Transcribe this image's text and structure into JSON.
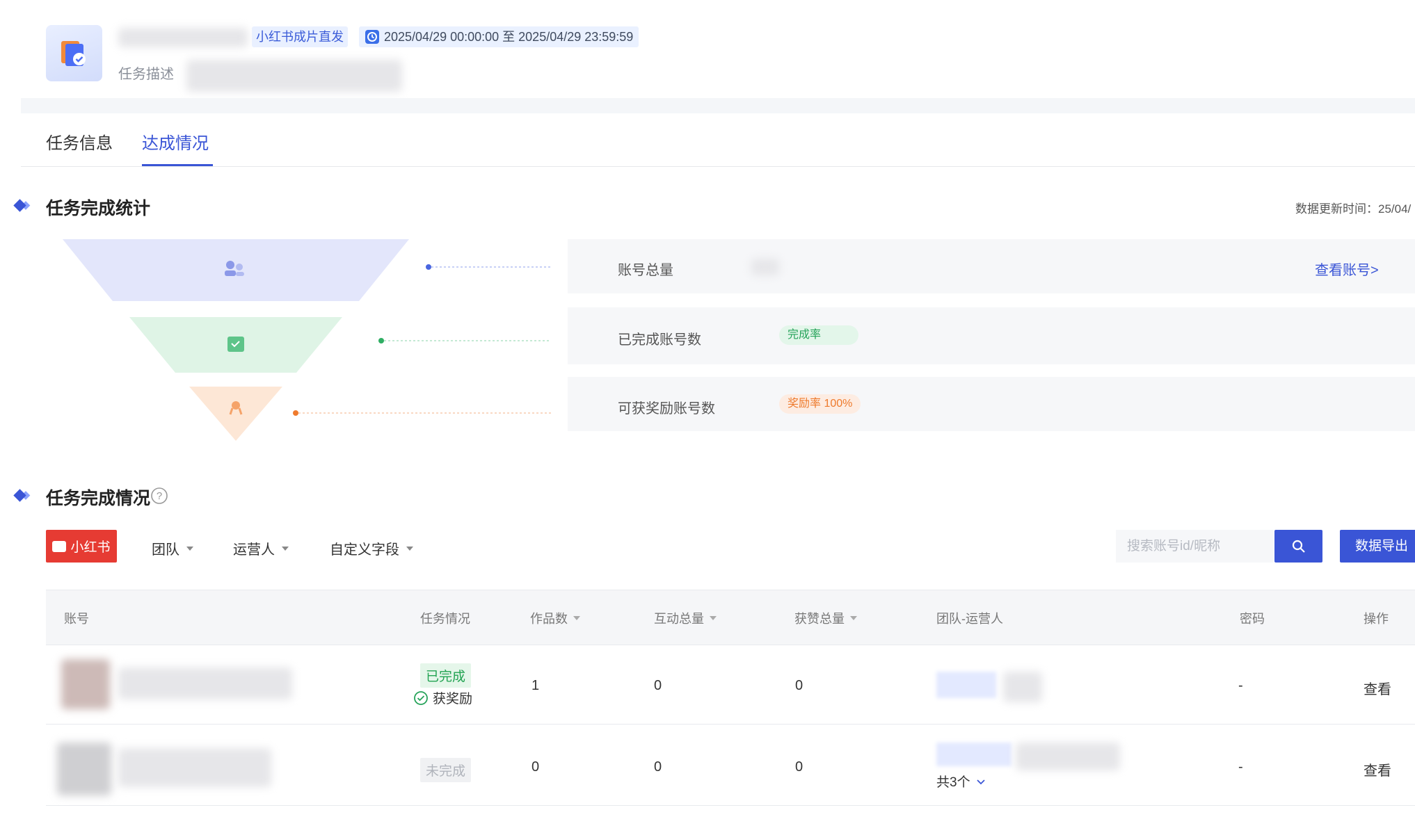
{
  "header": {
    "platform_tag": "小红书成片直发",
    "time_range": "2025/04/29 00:00:00 至 2025/04/29 23:59:59",
    "description_label": "任务描述"
  },
  "tabs": [
    {
      "label": "任务信息",
      "active": false
    },
    {
      "label": "达成情况",
      "active": true
    }
  ],
  "stats_section": {
    "title": "任务完成统计",
    "update_time": "数据更新时间：25/04/",
    "rows": [
      {
        "label": "账号总量",
        "link": "查看账号>"
      },
      {
        "label": "已完成账号数",
        "pill": "完成率"
      },
      {
        "label": "可获奖励账号数",
        "pill": "奖励率 100%"
      }
    ]
  },
  "completion_section": {
    "title": "任务完成情况",
    "platform_button": "小红书",
    "filters": [
      "团队",
      "运营人",
      "自定义字段"
    ],
    "search_placeholder": "搜索账号id/昵称",
    "export_label": "数据导出"
  },
  "table": {
    "columns": [
      "账号",
      "任务情况",
      "作品数",
      "互动总量",
      "获赞总量",
      "团队-运营人",
      "密码",
      "操作"
    ],
    "rows": [
      {
        "status": "已完成",
        "reward": "获奖励",
        "works": "1",
        "interactions": "0",
        "likes": "0",
        "team_extra": "",
        "password": "-",
        "action": "查看"
      },
      {
        "status": "未完成",
        "reward": "",
        "works": "0",
        "interactions": "0",
        "likes": "0",
        "team_extra": "共3个",
        "password": "-",
        "action": "查看"
      }
    ]
  },
  "colors": {
    "accent": "#3a55d6",
    "brand_red": "#e63b33",
    "success": "#26a35a",
    "warning": "#ee7a2c"
  }
}
